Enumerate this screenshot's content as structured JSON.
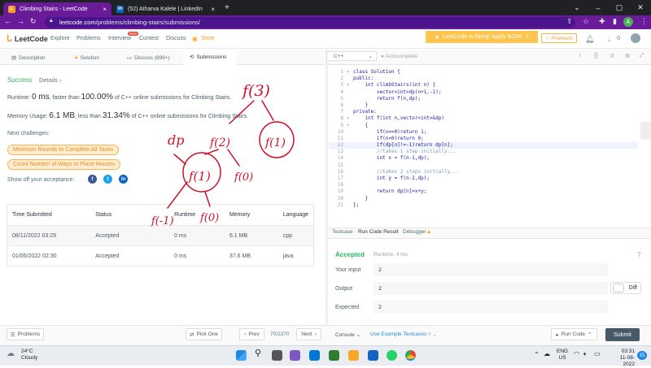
{
  "browser": {
    "tabs": [
      {
        "title": "Climbing Stairs - LeetCode",
        "favicon": "L"
      },
      {
        "title": "(52) Atharva Kalele | LinkedIn",
        "favicon": "in"
      }
    ],
    "url_domain": "leetcode.com",
    "url_path": "/problems/climbing-stairs/submissions/"
  },
  "header": {
    "logo": "LeetCode",
    "nav": [
      "Explore",
      "Problems",
      "Interview",
      "Contest",
      "Discuss",
      "Store"
    ],
    "new_badge": "New",
    "hiring": "LeetCode is hiring! Apply NOW.",
    "premium": "Premium",
    "notifications": "0"
  },
  "left_tabs": [
    "Description",
    "Solution",
    "Discuss (999+)",
    "Submissions"
  ],
  "result": {
    "status": "Success",
    "details": "Details",
    "runtime_prefix": "Runtime: ",
    "runtime_value": "0 ms",
    "runtime_mid": ", faster than ",
    "runtime_pct": "100.00%",
    "runtime_suffix": " of C++ online submissions for Climbing Stairs.",
    "memory_prefix": "Memory Usage: ",
    "memory_value": "6.1 MB",
    "memory_mid": ", less than ",
    "memory_pct": "31.34%",
    "memory_suffix": " of C++ online submissions for Climbing Stairs.",
    "next_challenges": "Next challenges:",
    "challenges": [
      "Minimum Rounds to Complete All Tasks",
      "Count Number of Ways to Place Houses"
    ],
    "share": "Show off your acceptance:"
  },
  "submissions": {
    "headers": [
      "Time Submitted",
      "Status",
      "Runtime",
      "Memory",
      "Language"
    ],
    "rows": [
      [
        "08/11/2022 03:29",
        "Accepted",
        "0 ms",
        "6.1 MB",
        "cpp"
      ],
      [
        "01/05/2022 02:30",
        "Accepted",
        "0 ms",
        "37.6 MB",
        "java"
      ]
    ]
  },
  "editor": {
    "language": "C++",
    "autocomplete": "Autocomplete",
    "lines": [
      "class Solution {",
      "public:",
      "    int climbStairs(int n) {",
      "        vector<int>dp(n+1,-1);",
      "        return f(n,dp);",
      "    }",
      "private:",
      "    int f(int n,vector<int>&dp)",
      "    {",
      "        if(n==0)return 1;",
      "        if(n<0)return 0;",
      "        if(dp[n]!=-1)return dp[n];",
      "        //takes 1 step initially...",
      "        int x = f(n-1,dp);",
      "",
      "        //takes 2 steps initially...",
      "        int y = f(n-2,dp);",
      "",
      "        return dp[n]=x+y;",
      "    }",
      "};"
    ]
  },
  "console": {
    "tabs": [
      "Testcase",
      "Run Code Result",
      "Debugger"
    ],
    "accepted": "Accepted",
    "runtime": "Runtime: 4 ms",
    "your_input_label": "Your input",
    "your_input": "2",
    "output_label": "Output",
    "output": "2",
    "expected_label": "Expected",
    "expected": "2",
    "diff": "Diff"
  },
  "bottom": {
    "problems": "Problems",
    "pick_one": "Pick One",
    "prev": "Prev",
    "page": "70/2370",
    "next": "Next",
    "console": "Console",
    "example": "Use Example Testcases",
    "run": "Run Code",
    "submit": "Submit"
  },
  "taskbar": {
    "temp": "24°C",
    "weather": "Cloudy",
    "lang1": "ENG",
    "lang2": "US",
    "time": "03:31",
    "date": "11-08-2022",
    "notif": "15"
  },
  "annotation_text": {
    "f3": "f(3)",
    "dp": "dp",
    "f2": "f(2)",
    "f1a": "f(1)",
    "f1b": "f(1)",
    "f0a": "f(0)",
    "f0b": "f(0)",
    "fm1": "f(-1)"
  }
}
